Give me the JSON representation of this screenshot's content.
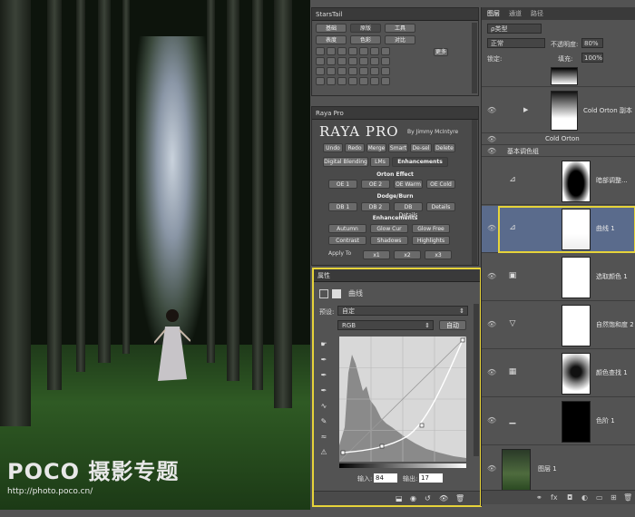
{
  "watermark": {
    "brand": "POCO 摄影专题",
    "url": "http://photo.poco.cn/"
  },
  "starstail": {
    "title": "StarsTail",
    "tabs_row1": [
      "基础",
      "原版",
      "工具"
    ],
    "tabs_row2": [
      "表度",
      "色彩",
      "对比"
    ],
    "more": "更多"
  },
  "raya": {
    "title": "Raya Pro",
    "logo": "RAYA PRO",
    "by": "By Jimmy McIntyre",
    "row1": [
      "Undo",
      "Redo",
      "Merge",
      "Smart",
      "De-sel",
      "Delete"
    ],
    "tabs": [
      "Digital Blending",
      "LMs",
      "Enhancements"
    ],
    "orton_label": "Orton Effect",
    "orton": [
      "OE 1",
      "OE 2",
      "OE Warm",
      "OE Cold"
    ],
    "dodge_label": "Dodge/Burn",
    "dodge": [
      "DB 1",
      "DB 2",
      "DB Details",
      "Details"
    ],
    "enh_label": "Enhancements",
    "enh1": [
      "Autumn",
      "Glow Cur",
      "Glow Free"
    ],
    "enh2": [
      "Contrast",
      "Shadows",
      "Highlights"
    ],
    "apply_label": "Apply To",
    "apply": [
      "x1",
      "x2",
      "x3"
    ]
  },
  "properties": {
    "title": "属性",
    "type_label": "曲线",
    "preset_label": "预设:",
    "preset_value": "自定",
    "channel_value": "RGB",
    "auto_label": "自动",
    "input_label": "输入:",
    "input_value": "84",
    "output_label": "输出:",
    "output_value": "17"
  },
  "layers": {
    "tabs": [
      "图层",
      "通道",
      "路径"
    ],
    "kind_label": "ρ类型",
    "blend_mode": "正常",
    "opacity_label": "不透明度:",
    "opacity_value": "80%",
    "lock_label": "锁定:",
    "fill_label": "填充:",
    "fill_value": "100%",
    "rows": [
      {
        "name": "Cold Orton 副本"
      },
      {
        "name": "Cold Orton"
      },
      {
        "name": "基本调色组"
      },
      {
        "name": "暗部调整..."
      },
      {
        "name": "曲线 1"
      },
      {
        "name": "选取颜色 1"
      },
      {
        "name": "自然饱和度 2"
      },
      {
        "name": "颜色查找 1"
      },
      {
        "name": "色阶 1"
      },
      {
        "name": "图层 1"
      }
    ]
  },
  "colors": {
    "highlight": "#e6d33a",
    "selected_row": "#5a6b8c"
  }
}
